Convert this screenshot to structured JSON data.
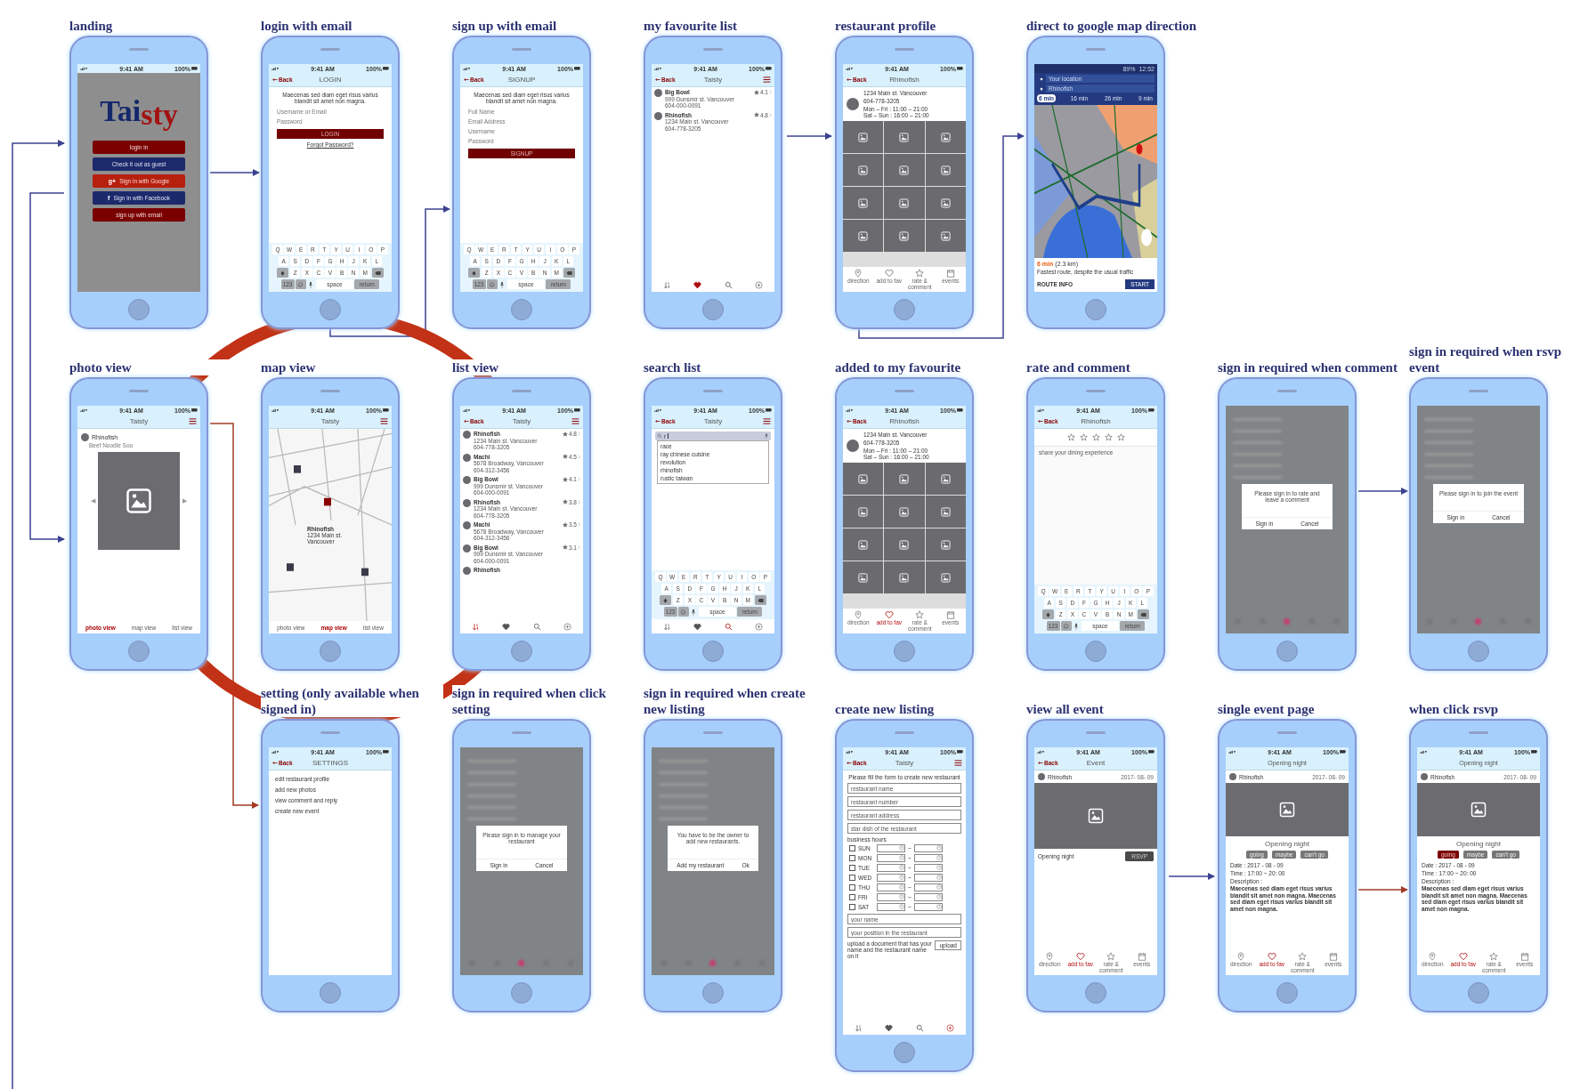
{
  "rows": [
    [
      {
        "title": "landing",
        "kind": "landing",
        "status": {
          "time": "9:41 AM",
          "battery": "100%"
        },
        "logo": [
          "Tai",
          "sty"
        ],
        "buttons": [
          {
            "label": "login in",
            "kind": "primary"
          },
          {
            "label": "Check it out as guest",
            "kind": "navy"
          },
          {
            "label": "Sign in with Google",
            "kind": "google",
            "icon": "g+"
          },
          {
            "label": "Sign in with Facebook",
            "kind": "facebook",
            "icon": "f"
          },
          {
            "label": "sign up with email",
            "kind": "primary"
          }
        ]
      },
      {
        "title": "login with email",
        "kind": "auth",
        "status": {
          "time": "9:41 AM",
          "battery": "100%"
        },
        "nav": {
          "back": "Back",
          "title": "LOGIN"
        },
        "intro": "Maecenas sed diam eget risus varius blandit sit amet non magna.",
        "fields": [
          {
            "placeholder": "Username or Email"
          },
          {
            "placeholder": "Password"
          }
        ],
        "submit": "LOGIN",
        "link": "Forgot Password?",
        "keyboard": {
          "rows": [
            "Q W E R T Y U I O P",
            "A S D F G H J K L",
            "Z X C V B N M"
          ],
          "numbers": "123",
          "space": "space",
          "return": "return"
        }
      },
      {
        "title": "sign up with email",
        "kind": "auth",
        "status": {
          "time": "9:41 AM",
          "battery": "100%"
        },
        "nav": {
          "back": "Back",
          "title": "SIGNUP"
        },
        "intro": "Maecenas sed diam eget risus varius blandit sit amet non magna.",
        "fields": [
          {
            "placeholder": "Full Name"
          },
          {
            "placeholder": "Email Address"
          },
          {
            "placeholder": "Username"
          },
          {
            "placeholder": "Password"
          }
        ],
        "submit": "SIGNUP",
        "keyboard": {
          "rows": [
            "Q W E R T Y U I O P",
            "A S D F G H J K L",
            "Z X C V B N M"
          ],
          "numbers": "123",
          "space": "space",
          "return": "return"
        }
      },
      {
        "title": "my favourite list",
        "kind": "list",
        "status": {
          "time": "9:41 AM",
          "battery": "100%"
        },
        "nav": {
          "back": "Back",
          "title": "Taisty",
          "menu": true
        },
        "items": [
          {
            "name": "Big Bowl",
            "address": "999 Dunsmir st. Vancouver",
            "phone": "604-000-0091",
            "rating": "4.1"
          },
          {
            "name": "Rhinofish",
            "address": "1234 Main st. Vancouver",
            "phone": "604-778-3205",
            "rating": "4.8"
          }
        ],
        "tabs": [
          {
            "selected": false
          },
          {
            "selected": true
          },
          {
            "selected": false
          },
          {
            "selected": false
          }
        ]
      },
      {
        "title": "restaurant profile",
        "kind": "profile",
        "status": {
          "time": "9:41 AM",
          "battery": "100%"
        },
        "nav": {
          "back": "Back",
          "title": "Rhinofish"
        },
        "info": {
          "address": "1234 Main st. Vancouver",
          "phone": "604-778-3205",
          "hours": [
            "Mon – Fri : 11:00 – 21:00",
            "Sat – Sun : 16:00 – 21:00"
          ]
        },
        "actions": [
          {
            "label": "direction",
            "selected": false
          },
          {
            "label": "add to fav",
            "selected": false
          },
          {
            "label": "rate & comment",
            "selected": false
          },
          {
            "label": "events",
            "selected": false
          }
        ]
      },
      {
        "title": "direct to google map direction",
        "kind": "gmap",
        "status": {
          "time": "12:52",
          "battery": "89%"
        },
        "from": "Your location",
        "to": "Rhinofish",
        "modes": [
          {
            "label": "6 min",
            "selected": true
          },
          {
            "label": "16 min",
            "selected": false
          },
          {
            "label": "26 min",
            "selected": false
          },
          {
            "label": "9 min",
            "selected": false
          }
        ],
        "eta": "6 min",
        "distance": "(2.3 km)",
        "note": "Fastest route, despite the usual traffic",
        "route_info": "ROUTE INFO",
        "start": "START"
      }
    ],
    [
      {
        "title": "photo view",
        "kind": "photo",
        "status": {
          "time": "9:41 AM",
          "battery": "100%"
        },
        "nav": {
          "title": "Taisty",
          "menu": true
        },
        "restaurant": "Rhinofish",
        "subtitle": "Beef Noodle Sou",
        "prev": "◀",
        "next": "▶",
        "views": [
          {
            "label": "photo view",
            "selected": true
          },
          {
            "label": "map view",
            "selected": false
          },
          {
            "label": "list view",
            "selected": false
          }
        ]
      },
      {
        "title": "map view",
        "kind": "map",
        "status": {
          "time": "9:41 AM",
          "battery": "100%"
        },
        "nav": {
          "title": "Taisty",
          "menu": true
        },
        "callout": {
          "name": "Rhinofish",
          "address": "1234 Main st. Vancouver"
        },
        "views": [
          {
            "label": "photo view",
            "selected": false
          },
          {
            "label": "map view",
            "selected": true
          },
          {
            "label": "list view",
            "selected": false
          }
        ]
      },
      {
        "title": "list view",
        "kind": "list",
        "status": {
          "time": "9:41 AM",
          "battery": "100%"
        },
        "nav": {
          "back": "Back",
          "title": "Taisty",
          "menu": true
        },
        "items": [
          {
            "name": "Rhinofish",
            "address": "1234 Main st. Vancouver",
            "phone": "604-778-3205",
            "rating": "4.8"
          },
          {
            "name": "Machi",
            "address": "5678 Broadway, Vancouver",
            "phone": "604-312-3456",
            "rating": "4.5"
          },
          {
            "name": "Big Bowl",
            "address": "999 Dunsmir st. Vancouver",
            "phone": "604-000-0091",
            "rating": "4.1"
          },
          {
            "name": "Rhinofish",
            "address": "1234 Main st. Vancouver",
            "phone": "604-778-3205",
            "rating": "3.8"
          },
          {
            "name": "Machi",
            "address": "5678 Broadway, Vancouver",
            "phone": "604-312-3456",
            "rating": "3.5"
          },
          {
            "name": "Big Bowl",
            "address": "999 Dunsmir st. Vancouver",
            "phone": "604-000-0091",
            "rating": "3.1"
          },
          {
            "name": "Rhinofish"
          }
        ],
        "tabs": [
          {
            "selected": true
          },
          {
            "selected": false
          },
          {
            "selected": false
          },
          {
            "selected": false
          }
        ]
      },
      {
        "title": "search  list",
        "kind": "search",
        "status": {
          "time": "9:41 AM",
          "battery": "100%"
        },
        "nav": {
          "back": "Back",
          "title": "Taisty",
          "menu": true
        },
        "query": "r",
        "suggestions": [
          "race",
          "ray chinese cuisine",
          "revolution",
          "rhinofish",
          "rustic taiwan"
        ],
        "keyboard": {
          "rows": [
            "Q W E R T Y U I O P",
            "A S D F G H J K L",
            "Z X C V B N M"
          ],
          "numbers": "123",
          "space": "space",
          "return": "return"
        },
        "tabs": [
          {
            "selected": false
          },
          {
            "selected": false
          },
          {
            "selected": true
          },
          {
            "selected": false
          }
        ]
      },
      {
        "title": "added to my favourite",
        "kind": "profile",
        "status": {
          "time": "9:41 AM",
          "battery": "100%"
        },
        "nav": {
          "back": "Back",
          "title": "Rhinofish"
        },
        "info": {
          "address": "1234 Main st. Vancouver",
          "phone": "604-778-3205",
          "hours": [
            "Mon – Fri : 11:00 – 21:00",
            "Sat – Sun : 16:00 – 21:00"
          ]
        },
        "actions": [
          {
            "label": "direction",
            "selected": false
          },
          {
            "label": "add to fav",
            "selected": true
          },
          {
            "label": "rate & comment",
            "selected": false
          },
          {
            "label": "events",
            "selected": false
          }
        ]
      },
      {
        "title": "rate and comment",
        "kind": "rate",
        "status": {
          "time": "9:41 AM",
          "battery": "100%"
        },
        "nav": {
          "back": "Back",
          "title": "Rhinofish"
        },
        "stars": 0,
        "placeholder": "share your dining experience",
        "keyboard": {
          "rows": [
            "Q W E R T Y U I O P",
            "A S D F G H J K L",
            "Z X C V B N M"
          ],
          "numbers": "123",
          "space": "space",
          "return": "return"
        }
      },
      {
        "title": "sign in required when comment",
        "kind": "modal",
        "message": "Please sign in to rate and leave a comment",
        "buttons": [
          "Sign in",
          "Cancel"
        ]
      },
      {
        "title": "sign in required when rsvp event",
        "kind": "modal",
        "message": "Please sign in to join the event",
        "buttons": [
          "Sign in",
          "Cancel"
        ]
      }
    ],
    [
      {
        "title": "setting (only available when signed in)",
        "kind": "settings",
        "status": {
          "time": "9:41 AM",
          "battery": "100%"
        },
        "nav": {
          "back": "Back",
          "title": "SETTINGS"
        },
        "options": [
          "edit restaurant profile",
          "add new photos",
          "view comment and reply",
          "create new event"
        ]
      },
      {
        "title": "sign in required when click setting",
        "kind": "modal",
        "message": "Please sign in to manage your restaurant",
        "buttons": [
          "Sign in",
          "Cancel"
        ]
      },
      {
        "title": "sign in required when create new listing",
        "kind": "modal",
        "message": "You have to be the owner to add new restaurants.",
        "buttons": [
          "Add my restaurant",
          "Ok"
        ]
      },
      {
        "title": "create new listing",
        "kind": "create",
        "status": {
          "time": "9:41 AM",
          "battery": "100%"
        },
        "nav": {
          "back": "Back",
          "title": "Taisty",
          "menu": true
        },
        "intro": "Please fill the form to create new restaurant",
        "fields": [
          {
            "placeholder": "restaurant name"
          },
          {
            "placeholder": "restaurant number"
          },
          {
            "placeholder": "restaurant address"
          },
          {
            "placeholder": "star dish of the restaurant"
          }
        ],
        "hours_label": "business hours",
        "days": [
          {
            "day": "SUN",
            "checked": false,
            "separator": "~"
          },
          {
            "day": "MON",
            "checked": false,
            "separator": "~"
          },
          {
            "day": "TUE",
            "checked": false,
            "separator": "~"
          },
          {
            "day": "WED",
            "checked": false,
            "separator": "~"
          },
          {
            "day": "THU",
            "checked": false,
            "separator": "~"
          },
          {
            "day": "FRI",
            "checked": false,
            "separator": "~"
          },
          {
            "day": "SAT",
            "checked": false,
            "separator": "~"
          }
        ],
        "owner_fields": [
          {
            "placeholder": "your name"
          },
          {
            "placeholder": "your position in the restaurant"
          }
        ],
        "upload_note": "upload a document that has your name and the restaurant name on it",
        "upload": "upload",
        "tabs": [
          {
            "selected": false
          },
          {
            "selected": false
          },
          {
            "selected": false
          },
          {
            "selected": true
          }
        ]
      },
      {
        "title": "view all event",
        "kind": "events",
        "status": {
          "time": "9:41 AM",
          "battery": "100%"
        },
        "nav": {
          "back": "Back",
          "title": "Event"
        },
        "host": "Rhinofish",
        "date": "2017- 08- 09",
        "caption": "Opening night",
        "rsvp": "RSVP",
        "actions": [
          {
            "label": "direction",
            "selected": false
          },
          {
            "label": "add to fav",
            "selected": true
          },
          {
            "label": "rate & comment",
            "selected": false
          },
          {
            "label": "events",
            "selected": false
          }
        ]
      },
      {
        "title": "single event page",
        "kind": "event",
        "status": {
          "time": "9:41 AM",
          "battery": "100%"
        },
        "header": "Opening night",
        "host": "Rhinofish",
        "date": "2017- 08- 09",
        "name": "Opening night",
        "options": [
          {
            "label": "going",
            "selected": false
          },
          {
            "label": "maybe",
            "selected": false
          },
          {
            "label": "can't go",
            "selected": false
          }
        ],
        "date_line": "Date : 2017 - 08 - 09",
        "time_line": "Time : 17:00 ~ 20: 00",
        "description_label": "Description :",
        "description": "Maecenas sed diam eget risus varius blandit sit amet non magna. Maecenas sed diam eget risus varius blandit sit amet non magna.",
        "actions": [
          {
            "label": "direction",
            "selected": false
          },
          {
            "label": "add to fav",
            "selected": true
          },
          {
            "label": "rate & comment",
            "selected": false
          },
          {
            "label": "events",
            "selected": false
          }
        ]
      },
      {
        "title": "when click rsvp",
        "kind": "event",
        "status": {
          "time": "9:41 AM",
          "battery": "100%"
        },
        "header": "Opening night",
        "host": "Rhinofish",
        "date": "2017- 08- 09",
        "name": "Opening night",
        "options": [
          {
            "label": "going",
            "selected": true
          },
          {
            "label": "maybe",
            "selected": false
          },
          {
            "label": "can't go",
            "selected": false
          }
        ],
        "date_line": "Date : 2017 - 08 - 09",
        "time_line": "Time : 17:00 ~ 20: 00",
        "description_label": "Description :",
        "description": "Maecenas sed diam eget risus varius blandit sit amet non magna. Maecenas sed diam eget risus varius blandit sit amet non magna.",
        "actions": [
          {
            "label": "direction",
            "selected": false
          },
          {
            "label": "add to fav",
            "selected": true
          },
          {
            "label": "rate & comment",
            "selected": false
          },
          {
            "label": "events",
            "selected": false
          }
        ]
      }
    ]
  ]
}
